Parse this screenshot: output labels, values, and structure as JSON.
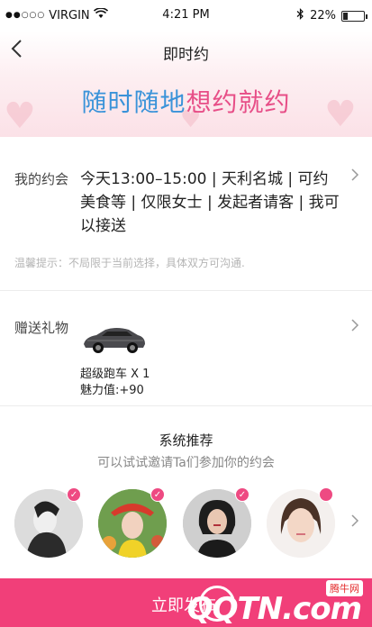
{
  "status_bar": {
    "signal": "●●○○○",
    "carrier": "VIRGIN",
    "time": "4:21 PM",
    "battery_text": "22%",
    "battery_level": 0.22
  },
  "nav": {
    "title": "即时约",
    "back_icon": "chevron-left-icon"
  },
  "banner": {
    "slogan_part1": "随时随地",
    "slogan_part2": "想约就约",
    "colors": {
      "part1": "#3a93d9",
      "part2": "#e74e87"
    }
  },
  "appointment": {
    "label": "我的约会",
    "details": "今天13:00–15:00 | 天利名城 | 可约美食等 | 仅限女士 | 发起者请客 | 我可以接送",
    "tip": "温馨提示：不局限于当前选择，具体双方可沟通."
  },
  "gift": {
    "label": "赠送礼物",
    "name": "超级跑车 X 1",
    "charm": "魅力值:+90",
    "icon": "sports-car-icon"
  },
  "recommend": {
    "title": "系统推荐",
    "subtitle": "可以试试邀请Ta们参加你的约会",
    "users": [
      {
        "selected": true
      },
      {
        "selected": true
      },
      {
        "selected": true
      },
      {
        "selected": false
      }
    ]
  },
  "bottom": {
    "label": "立即发布",
    "accent": "#f13f79"
  },
  "watermark": {
    "brand": "QQTN.com",
    "tag": "腾牛网"
  }
}
